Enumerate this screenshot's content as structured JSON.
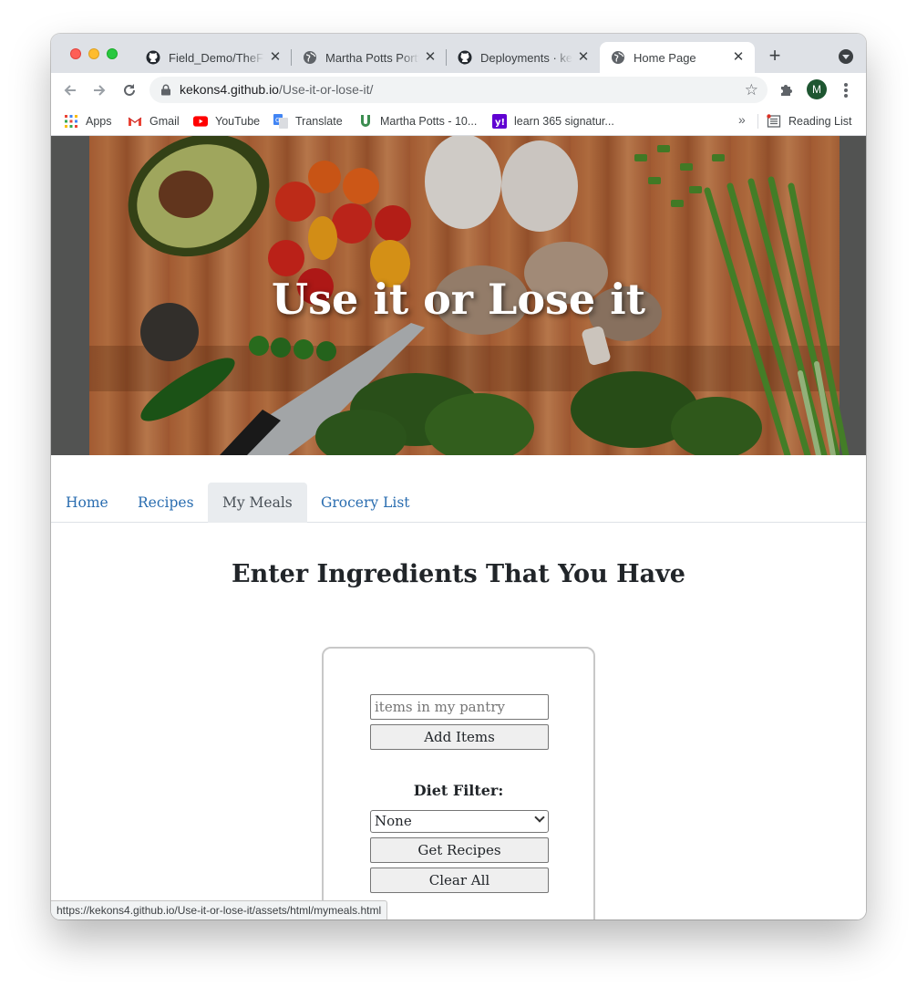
{
  "browser": {
    "tabs": [
      {
        "title": "Field_Demo/TheFi",
        "icon": "github-icon",
        "active": false
      },
      {
        "title": "Martha Potts Portf",
        "icon": "globe-icon",
        "active": false
      },
      {
        "title": "Deployments · kek",
        "icon": "github-icon",
        "active": false
      },
      {
        "title": "Home Page",
        "icon": "globe-icon",
        "active": true
      }
    ],
    "address": {
      "host": "kekons4.github.io",
      "path": "/Use-it-or-lose-it/"
    },
    "profile_initial": "M",
    "bookmarks": [
      {
        "label": "Apps",
        "icon": "apps-grid-icon"
      },
      {
        "label": "Gmail",
        "icon": "gmail-icon"
      },
      {
        "label": "YouTube",
        "icon": "youtube-icon"
      },
      {
        "label": "Translate",
        "icon": "translate-icon"
      },
      {
        "label": "Martha Potts - 10...",
        "icon": "bookmark-u-icon"
      },
      {
        "label": "learn 365 signatur...",
        "icon": "yahoo-icon"
      }
    ],
    "bookmarks_overflow": "»",
    "reading_list": "Reading List",
    "status_url": "https://kekons4.github.io/Use-it-or-lose-it/assets/html/mymeals.html"
  },
  "site": {
    "hero_title": "Use it or Lose it",
    "nav": [
      {
        "label": "Home",
        "active": false
      },
      {
        "label": "Recipes",
        "active": false
      },
      {
        "label": "My Meals",
        "active": true
      },
      {
        "label": "Grocery List",
        "active": false
      }
    ],
    "heading": "Enter Ingredients That You Have",
    "form": {
      "input_placeholder": "items in my pantry",
      "add_button": "Add Items",
      "diet_label": "Diet Filter:",
      "diet_selected": "None",
      "get_recipes_button": "Get Recipes",
      "clear_button": "Clear All"
    }
  }
}
